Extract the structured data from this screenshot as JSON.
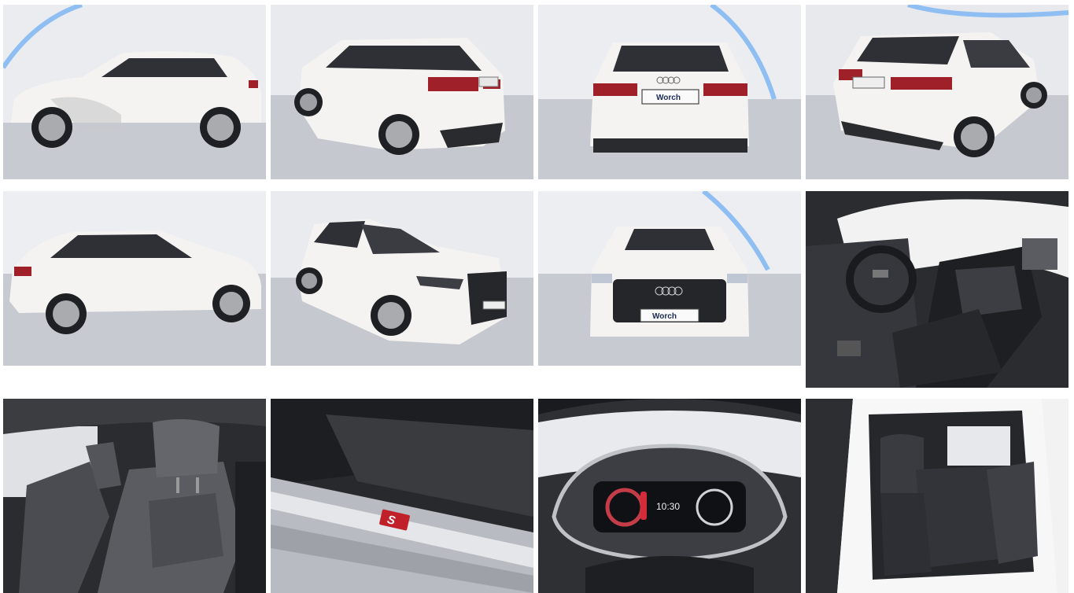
{
  "gallery": {
    "dealer_plate": "Worch",
    "badge_text": "S",
    "cluster_time": "10:30",
    "photos": [
      {
        "icon": "car-side-left-photo"
      },
      {
        "icon": "car-rear-three-quarter-photo"
      },
      {
        "icon": "car-rear-photo"
      },
      {
        "icon": "car-rear-three-quarter-right-photo"
      },
      {
        "icon": "car-side-right-photo"
      },
      {
        "icon": "car-front-three-quarter-photo"
      },
      {
        "icon": "car-front-photo"
      },
      {
        "icon": "car-interior-front-photo"
      },
      {
        "icon": "car-front-seats-photo"
      },
      {
        "icon": "car-door-sill-photo"
      },
      {
        "icon": "car-instrument-cluster-photo"
      },
      {
        "icon": "car-rear-seats-photo"
      }
    ]
  },
  "colors": {
    "body_white": "#f4f3f1",
    "studio_wall": "#e9eaee",
    "studio_floor": "#c9cbd2",
    "led_strip": "#7fb3f0",
    "tail_light": "#a0202a",
    "interior_dark": "#2b2c30"
  }
}
